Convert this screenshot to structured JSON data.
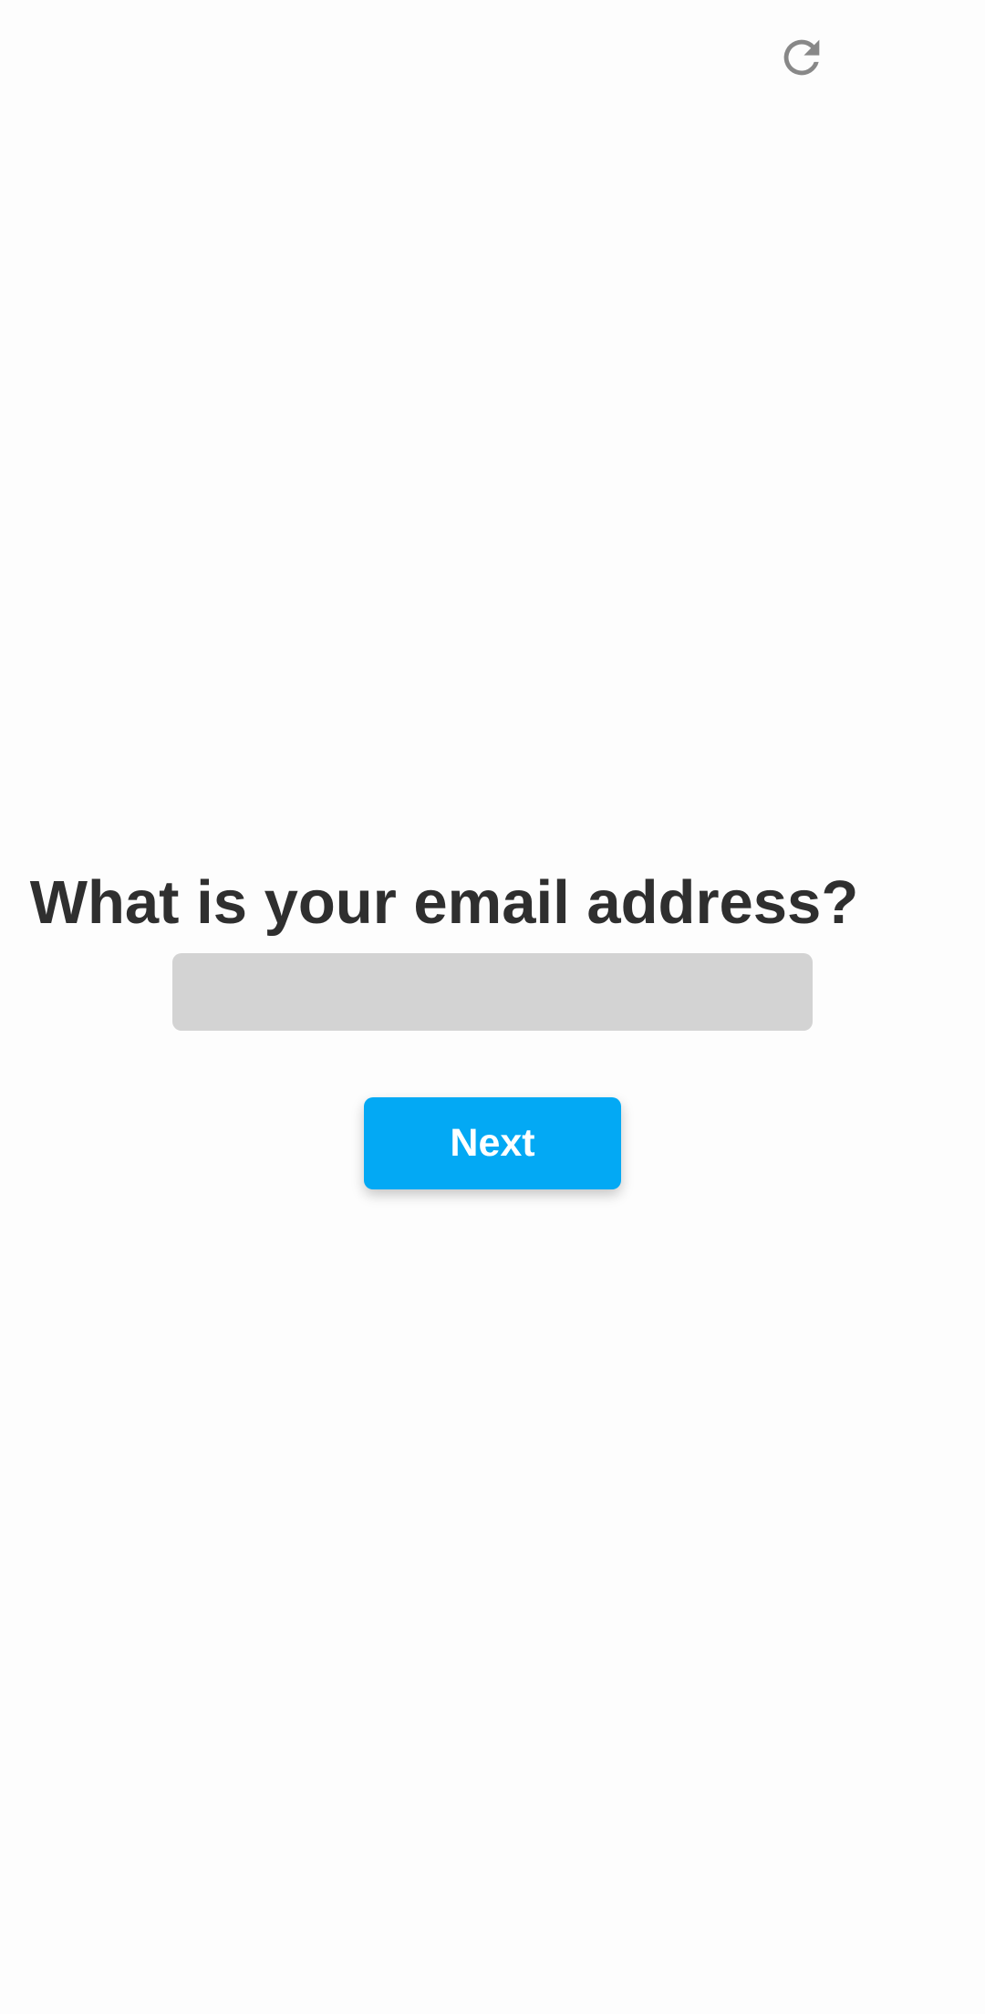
{
  "toolbar": {
    "reload_icon": "reload-icon"
  },
  "form": {
    "prompt": "What is your email address?",
    "email_value": "",
    "email_placeholder": "",
    "next_label": "Next"
  },
  "colors": {
    "background": "#fdfdfd",
    "prompt_text": "#2f2f2f",
    "input_fill": "#d3d3d3",
    "button_fill": "#03a9f4",
    "button_text": "#ffffff",
    "icon": "#888888"
  }
}
